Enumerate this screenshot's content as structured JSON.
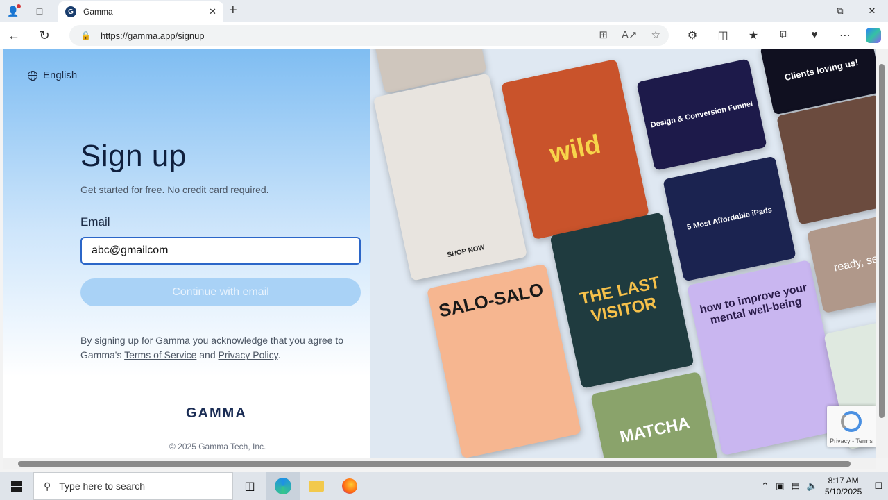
{
  "browser": {
    "tab_title": "Gamma",
    "tab_favicon": "G",
    "url": "https://gamma.app/signup"
  },
  "page": {
    "language": "English",
    "title": "Sign up",
    "subtitle": "Get started for free. No credit card required.",
    "email_label": "Email",
    "email_value": "abc@gmailcom",
    "continue_label": "Continue with email",
    "legal_prefix": "By signing up for Gamma you acknowledge that you agree to Gamma's ",
    "terms_label": "Terms of Service",
    "legal_and": " and ",
    "privacy_label": "Privacy Policy",
    "legal_suffix": ".",
    "logo": "GAMMA",
    "copyright": "© 2025 Gamma Tech, Inc."
  },
  "gallery": {
    "cards": [
      {
        "text": "",
        "color": "#cfc6bd"
      },
      {
        "text": "wild",
        "color": "#c9532b"
      },
      {
        "text": "Design & Conversion Funnel",
        "color": "#1d1a4a"
      },
      {
        "text": "Clients loving us!",
        "color": "#101020"
      },
      {
        "text": "",
        "color": "#6b4b3e"
      },
      {
        "text": "5 Most Affordable iPads",
        "color": "#1b2350"
      },
      {
        "text": "SHOP NOW",
        "color": "#e8e4df"
      },
      {
        "text": "SALO-SALO",
        "color": "#f6b690"
      },
      {
        "text": "THE LAST VISITOR",
        "color": "#1f3b3f"
      },
      {
        "text": "how to improve your mental well-being",
        "color": "#c9b6f0"
      },
      {
        "text": "ready, se",
        "color": "#b0988a"
      },
      {
        "text": "MATCHA",
        "color": "#8aa36b"
      },
      {
        "text": "",
        "color": "#dfe9e0"
      }
    ]
  },
  "recaptcha": {
    "label": "Privacy - Terms"
  },
  "taskbar": {
    "search_placeholder": "Type here to search",
    "time": "8:17 AM",
    "date": "5/10/2025"
  }
}
